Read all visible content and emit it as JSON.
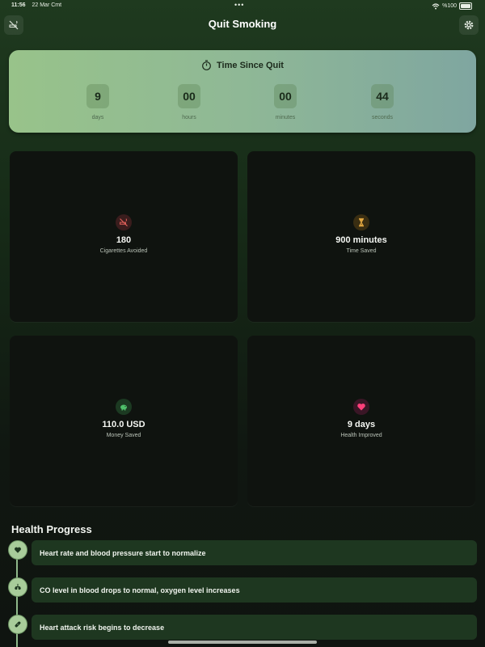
{
  "status_bar": {
    "time": "11:56",
    "date": "22 Mar Cmt",
    "battery": "%100"
  },
  "header": {
    "title": "Quit Smoking"
  },
  "timer": {
    "title": "Time Since Quit",
    "units": [
      {
        "value": "9",
        "label": "days"
      },
      {
        "value": "00",
        "label": "hours"
      },
      {
        "value": "00",
        "label": "minutes"
      },
      {
        "value": "44",
        "label": "seconds"
      }
    ]
  },
  "stats": [
    {
      "value": "180",
      "label": "Cigarettes Avoided",
      "icon": "no-smoking-icon",
      "color": "#e0605a"
    },
    {
      "value": "900 minutes",
      "label": "Time Saved",
      "icon": "hourglass-icon",
      "color": "#e0a640"
    },
    {
      "value": "110.0 USD",
      "label": "Money Saved",
      "icon": "piggy-bank-icon",
      "color": "#4fc06a"
    },
    {
      "value": "9 days",
      "label": "Health Improved",
      "icon": "heart-icon",
      "color": "#ff3f7a"
    }
  ],
  "health_progress": {
    "title": "Health Progress",
    "items": [
      {
        "text": "Heart rate and blood pressure start to normalize",
        "icon": "heart-icon"
      },
      {
        "text": "CO level in blood drops to normal, oxygen level increases",
        "icon": "lungs-icon"
      },
      {
        "text": "Heart attack risk begins to decrease",
        "icon": "bandage-icon"
      }
    ]
  },
  "colors": {
    "accent": "#98c38a",
    "card_bg": "#0f130f",
    "timeline_card": "#1e3720"
  }
}
